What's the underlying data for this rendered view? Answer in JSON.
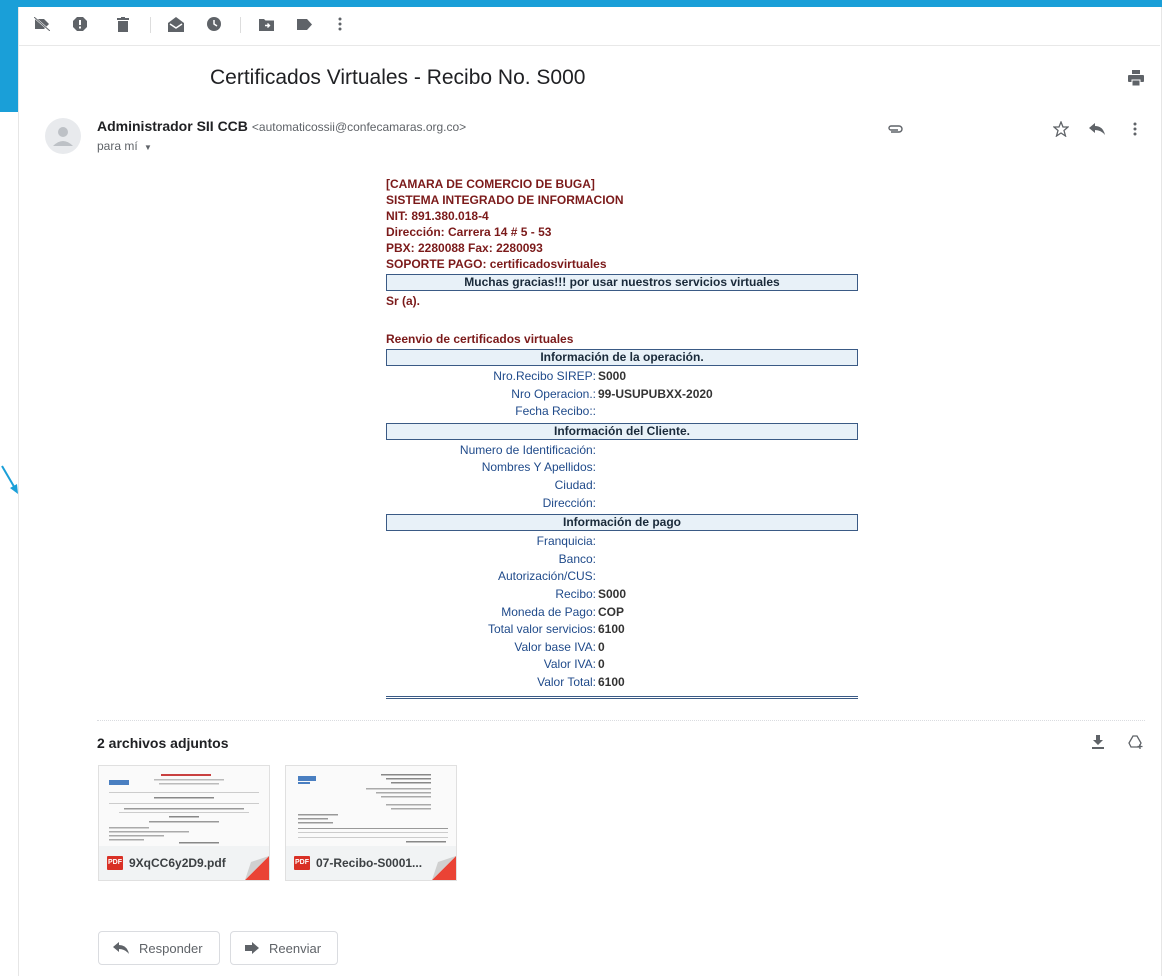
{
  "toolbar": {
    "icons": [
      "archive-icon",
      "report-spam-icon",
      "delete-icon",
      "mark-unread-icon",
      "snooze-icon",
      "move-to-icon",
      "label-icon",
      "more-vert-icon"
    ]
  },
  "message": {
    "subject": "Certificados Virtuales - Recibo No. S000",
    "sender_name": "Administrador SII CCB",
    "sender_email": "<automaticossii@confecamaras.org.co>",
    "to": "para mí"
  },
  "receipt": {
    "org_lines": [
      "[CAMARA DE COMERCIO DE BUGA]",
      "SISTEMA INTEGRADO DE INFORMACION",
      "NIT: 891.380.018-4",
      "Dirección: Carrera 14 # 5 - 53",
      "PBX: 2280088 Fax: 2280093",
      "SOPORTE PAGO: certificadosvirtuales"
    ],
    "thanks": "Muchas gracias!!! por usar nuestros servicios virtuales",
    "greeting": "Sr (a).",
    "reenvio": "Reenvio de certificados virtuales",
    "op_header": "Información de la operación.",
    "operation": [
      {
        "k": "Nro.Recibo SIREP:",
        "v": "S000"
      },
      {
        "k": "Nro Operacion.:",
        "v": "99-USUPUBXX-2020"
      },
      {
        "k": "Fecha Recibo::",
        "v": ""
      }
    ],
    "client_header": "Información del Cliente.",
    "client": [
      {
        "k": "Numero de Identificación:",
        "v": ""
      },
      {
        "k": "Nombres Y Apellidos:",
        "v": ""
      },
      {
        "k": "Ciudad:",
        "v": ""
      },
      {
        "k": "Dirección:",
        "v": ""
      }
    ],
    "pay_header": "Información de pago",
    "payment": [
      {
        "k": "Franquicia:",
        "v": ""
      },
      {
        "k": "Banco:",
        "v": ""
      },
      {
        "k": "Autorización/CUS:",
        "v": ""
      },
      {
        "k": "Recibo:",
        "v": "S000"
      },
      {
        "k": "Moneda de Pago:",
        "v": "COP"
      },
      {
        "k": "Total valor servicios:",
        "v": "6100"
      },
      {
        "k": "Valor base IVA:",
        "v": "0"
      },
      {
        "k": "Valor IVA:",
        "v": "0"
      },
      {
        "k": "Valor Total:",
        "v": "6100"
      }
    ]
  },
  "attachments": {
    "title": "2 archivos adjuntos",
    "files": [
      {
        "name": "9XqCC6y2D9.pdf",
        "badge": "PDF"
      },
      {
        "name": "07-Recibo-S0001...",
        "badge": "PDF"
      }
    ]
  },
  "actions": {
    "reply": "Responder",
    "forward": "Reenviar"
  },
  "colors": {
    "frame_blue": "#1a9fd8",
    "org_text": "#7b1a1a",
    "label_blue": "#1f4a8a",
    "pdf_red": "#d93025"
  }
}
